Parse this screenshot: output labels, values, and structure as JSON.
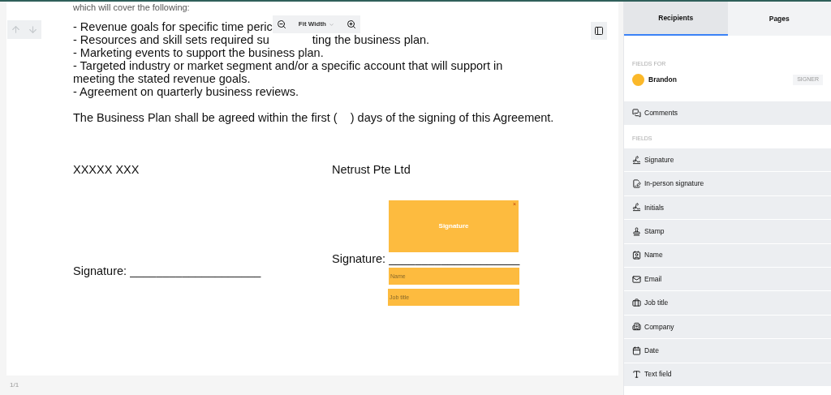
{
  "toolbar": {
    "zoom_label": "Fit Width"
  },
  "document": {
    "intro": "which will cover the following:",
    "bullet_first": "- Revenue goals for specific time peric",
    "bullet_second_start": "- Resources and skill sets required su",
    "bullet_second_end": "ting the business plan.",
    "bullets": [
      "- Marketing events to support the business plan.",
      "- Targeted industry or market segment and/or a specific account that will support in meeting the stated revenue goals.",
      "- Agreement on quarterly business reviews."
    ],
    "clause": "The Business Plan shall be agreed within the first (    ) days of the signing of this Agreement.",
    "parties": [
      {
        "name": "XXXXX XXX",
        "signature_label": "Signature: ____________________"
      },
      {
        "name": "Netrust Pte Ltd",
        "signature_label": "Signature: ____________________"
      }
    ],
    "placed_fields": {
      "signature": "Signature",
      "close": "×",
      "name_placeholder": "Name",
      "job_title_placeholder": "Job title"
    }
  },
  "page_indicator": "1/1",
  "sidebar": {
    "tabs": [
      {
        "label": "Recipients",
        "selected": true
      },
      {
        "label": "Pages",
        "selected": false
      }
    ],
    "fields_for_heading": "FIELDS FOR",
    "recipient": {
      "name": "Brandon",
      "role": "SIGNER",
      "color": "#fbb829"
    },
    "comments": "Comments",
    "fields_heading": "FIELDS",
    "fields": [
      {
        "kind": "signature",
        "label": "Signature"
      },
      {
        "kind": "inperson",
        "label": "In-person signature"
      },
      {
        "kind": "initials",
        "label": "Initials"
      },
      {
        "kind": "stamp",
        "label": "Stamp"
      },
      {
        "kind": "name",
        "label": "Name"
      },
      {
        "kind": "email",
        "label": "Email"
      },
      {
        "kind": "job",
        "label": "Job title"
      },
      {
        "kind": "company",
        "label": "Company"
      },
      {
        "kind": "date",
        "label": "Date"
      },
      {
        "kind": "text",
        "label": "Text field"
      }
    ]
  }
}
